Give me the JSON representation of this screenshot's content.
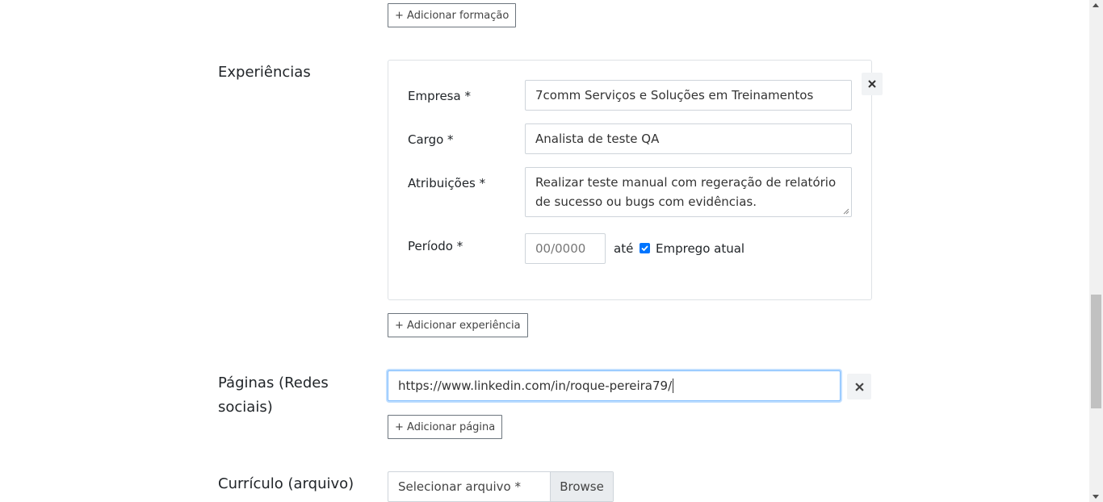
{
  "education": {
    "add_button": "+ Adicionar formação"
  },
  "experience": {
    "section_label": "Experiências",
    "company_label": "Empresa *",
    "company_value": "7comm Serviços e Soluções em Treinamentos",
    "role_label": "Cargo *",
    "role_value": "Analista de teste QA",
    "duties_label": "Atribuições *",
    "duties_value": "Realizar teste manual com regeração de relatório de sucesso ou bugs com evidências.",
    "period_label": "Período *",
    "period_placeholder": "00/0000",
    "until_label": "até",
    "current_job_label": "Emprego atual",
    "current_job_checked": true,
    "remove_icon": "close-icon",
    "add_button": "+ Adicionar experiência"
  },
  "pages": {
    "section_label_line1": "Páginas (Redes",
    "section_label_line2": "sociais)",
    "url_value": "https://www.linkedin.com/in/roque-pereira79/",
    "remove_icon": "close-icon",
    "add_button": "+ Adicionar página"
  },
  "resume": {
    "section_label": "Currículo (arquivo)",
    "file_placeholder": "Selecionar arquivo *",
    "browse_label": "Browse"
  },
  "colors": {
    "checkbox_accent": "#0075ff",
    "focus_border": "#80bdff"
  }
}
